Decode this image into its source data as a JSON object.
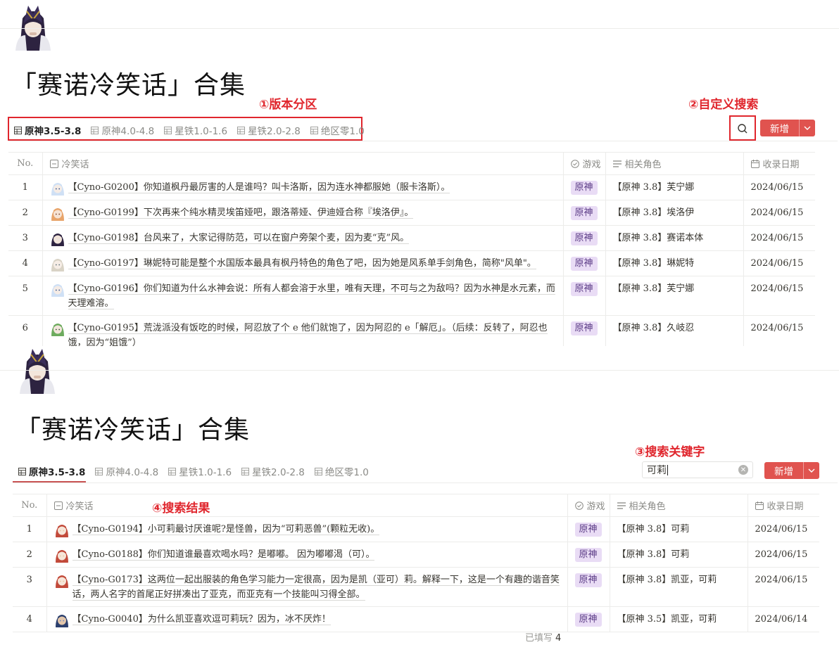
{
  "page": {
    "title": "「赛诺冷笑话」合集"
  },
  "tabs": [
    {
      "label": "原神3.5-3.8",
      "active": true
    },
    {
      "label": "原神4.0-4.8",
      "active": false
    },
    {
      "label": "星铁1.0-1.6",
      "active": false
    },
    {
      "label": "星铁2.0-2.8",
      "active": false
    },
    {
      "label": "绝区零1.0",
      "active": false
    }
  ],
  "annotations": {
    "version_tabs": "①版本分区",
    "custom_search": "②自定义搜索",
    "search_keyword": "③搜索关键字",
    "search_results": "④搜索结果"
  },
  "toolbar": {
    "new_label": "新增",
    "search_value": "可莉"
  },
  "columns": {
    "no": "No.",
    "joke": "冷笑话",
    "game": "游戏",
    "roles": "相关角色",
    "date": "收录日期"
  },
  "colors": {
    "accent": "#e0534f",
    "annotation": "#e0262d",
    "tag_bg": "#e9dcf5"
  },
  "icons": [
    "table-icon",
    "search-icon",
    "chevron-down-icon",
    "text-icon",
    "check-circle-icon",
    "list-icon",
    "calendar-icon",
    "clear-icon"
  ],
  "table_all": [
    {
      "no": "1",
      "avatar": "furina-avatar",
      "text": "【Cyno-G0200】你知道枫丹最厉害的人是谁吗？叫卡洛斯，因为连水神都服她（服卡洛斯）。",
      "game": "原神",
      "roles": "【原神 3.8】芙宁娜",
      "date": "2024/06/15"
    },
    {
      "no": "2",
      "avatar": "lyney-avatar",
      "text": "【Cyno-G0199】下次再来个纯水精灵埃笛娅吧，跟洛蒂娅、伊迪娅合称『埃洛伊』。",
      "game": "原神",
      "roles": "【原神 3.8】埃洛伊",
      "date": "2024/06/15"
    },
    {
      "no": "3",
      "avatar": "cyno-avatar",
      "text": "【Cyno-G0198】台风来了，大家记得防范，可以在窗户旁架个麦，因为麦“克”风。",
      "game": "原神",
      "roles": "【原神 3.8】赛诺本体",
      "date": "2024/06/15"
    },
    {
      "no": "4",
      "avatar": "lynette-avatar",
      "text": "【Cyno-G0197】琳妮特可能是整个水国版本最具有枫丹特色的角色了吧，因为她是风系单手剑角色，简称\"风单\"。",
      "game": "原神",
      "roles": "【原神 3.8】琳妮特",
      "date": "2024/06/15"
    },
    {
      "no": "5",
      "avatar": "furina-avatar",
      "text": "【Cyno-G0196】你们知道为什么水神会说：所有人都会溶于水里，唯有天理，不可与之为敌吗？因为水神是水元素，而天理难溶。",
      "game": "原神",
      "roles": "【原神 3.8】芙宁娜",
      "date": "2024/06/15"
    },
    {
      "no": "6",
      "avatar": "kuki-avatar",
      "text": "【Cyno-G0195】荒泷派没有饭吃的时候，阿忍放了个 e 他们就饱了，因为阿忍的 e「解厄」。（后续：反转了，阿忍也饿，因为“姐饿”）",
      "game": "原神",
      "roles": "【原神 3.8】久岐忍",
      "date": "2024/06/15"
    }
  ],
  "table_search": [
    {
      "no": "1",
      "avatar": "klee-avatar",
      "text": "【Cyno-G0194】小可莉最讨厌谁呢?是怪兽，因为“可莉恶兽”(颗粒无收)。",
      "game": "原神",
      "roles": "【原神 3.8】可莉",
      "date": "2024/06/15"
    },
    {
      "no": "2",
      "avatar": "klee-avatar",
      "text": "【Cyno-G0188】你们知道谁最喜欢喝水吗？是嘟嘟。 因为嘟嘟渴（可）。",
      "game": "原神",
      "roles": "【原神 3.8】可莉",
      "date": "2024/06/15"
    },
    {
      "no": "3",
      "avatar": "klee-avatar",
      "text": "【Cyno-G0173】这两位一起出服装的角色学习能力一定很高，因为是凯（亚可）莉。解释一下，这是一个有趣的谐音笑话，两人名字的首尾正好拼凑出了亚克，而亚克有一个技能叫习得全部。",
      "game": "原神",
      "roles": "【原神 3.8】凯亚，可莉",
      "date": "2024/06/15"
    },
    {
      "no": "4",
      "avatar": "kaeya-avatar",
      "text": "【Cyno-G0040】为什么凯亚喜欢逗可莉玩？因为，冰不厌炸！",
      "game": "原神",
      "roles": "【原神 3.5】凯亚，可莉",
      "date": "2024/06/14"
    }
  ],
  "footer": {
    "filled_label": "已填写",
    "filled_count": "4"
  }
}
